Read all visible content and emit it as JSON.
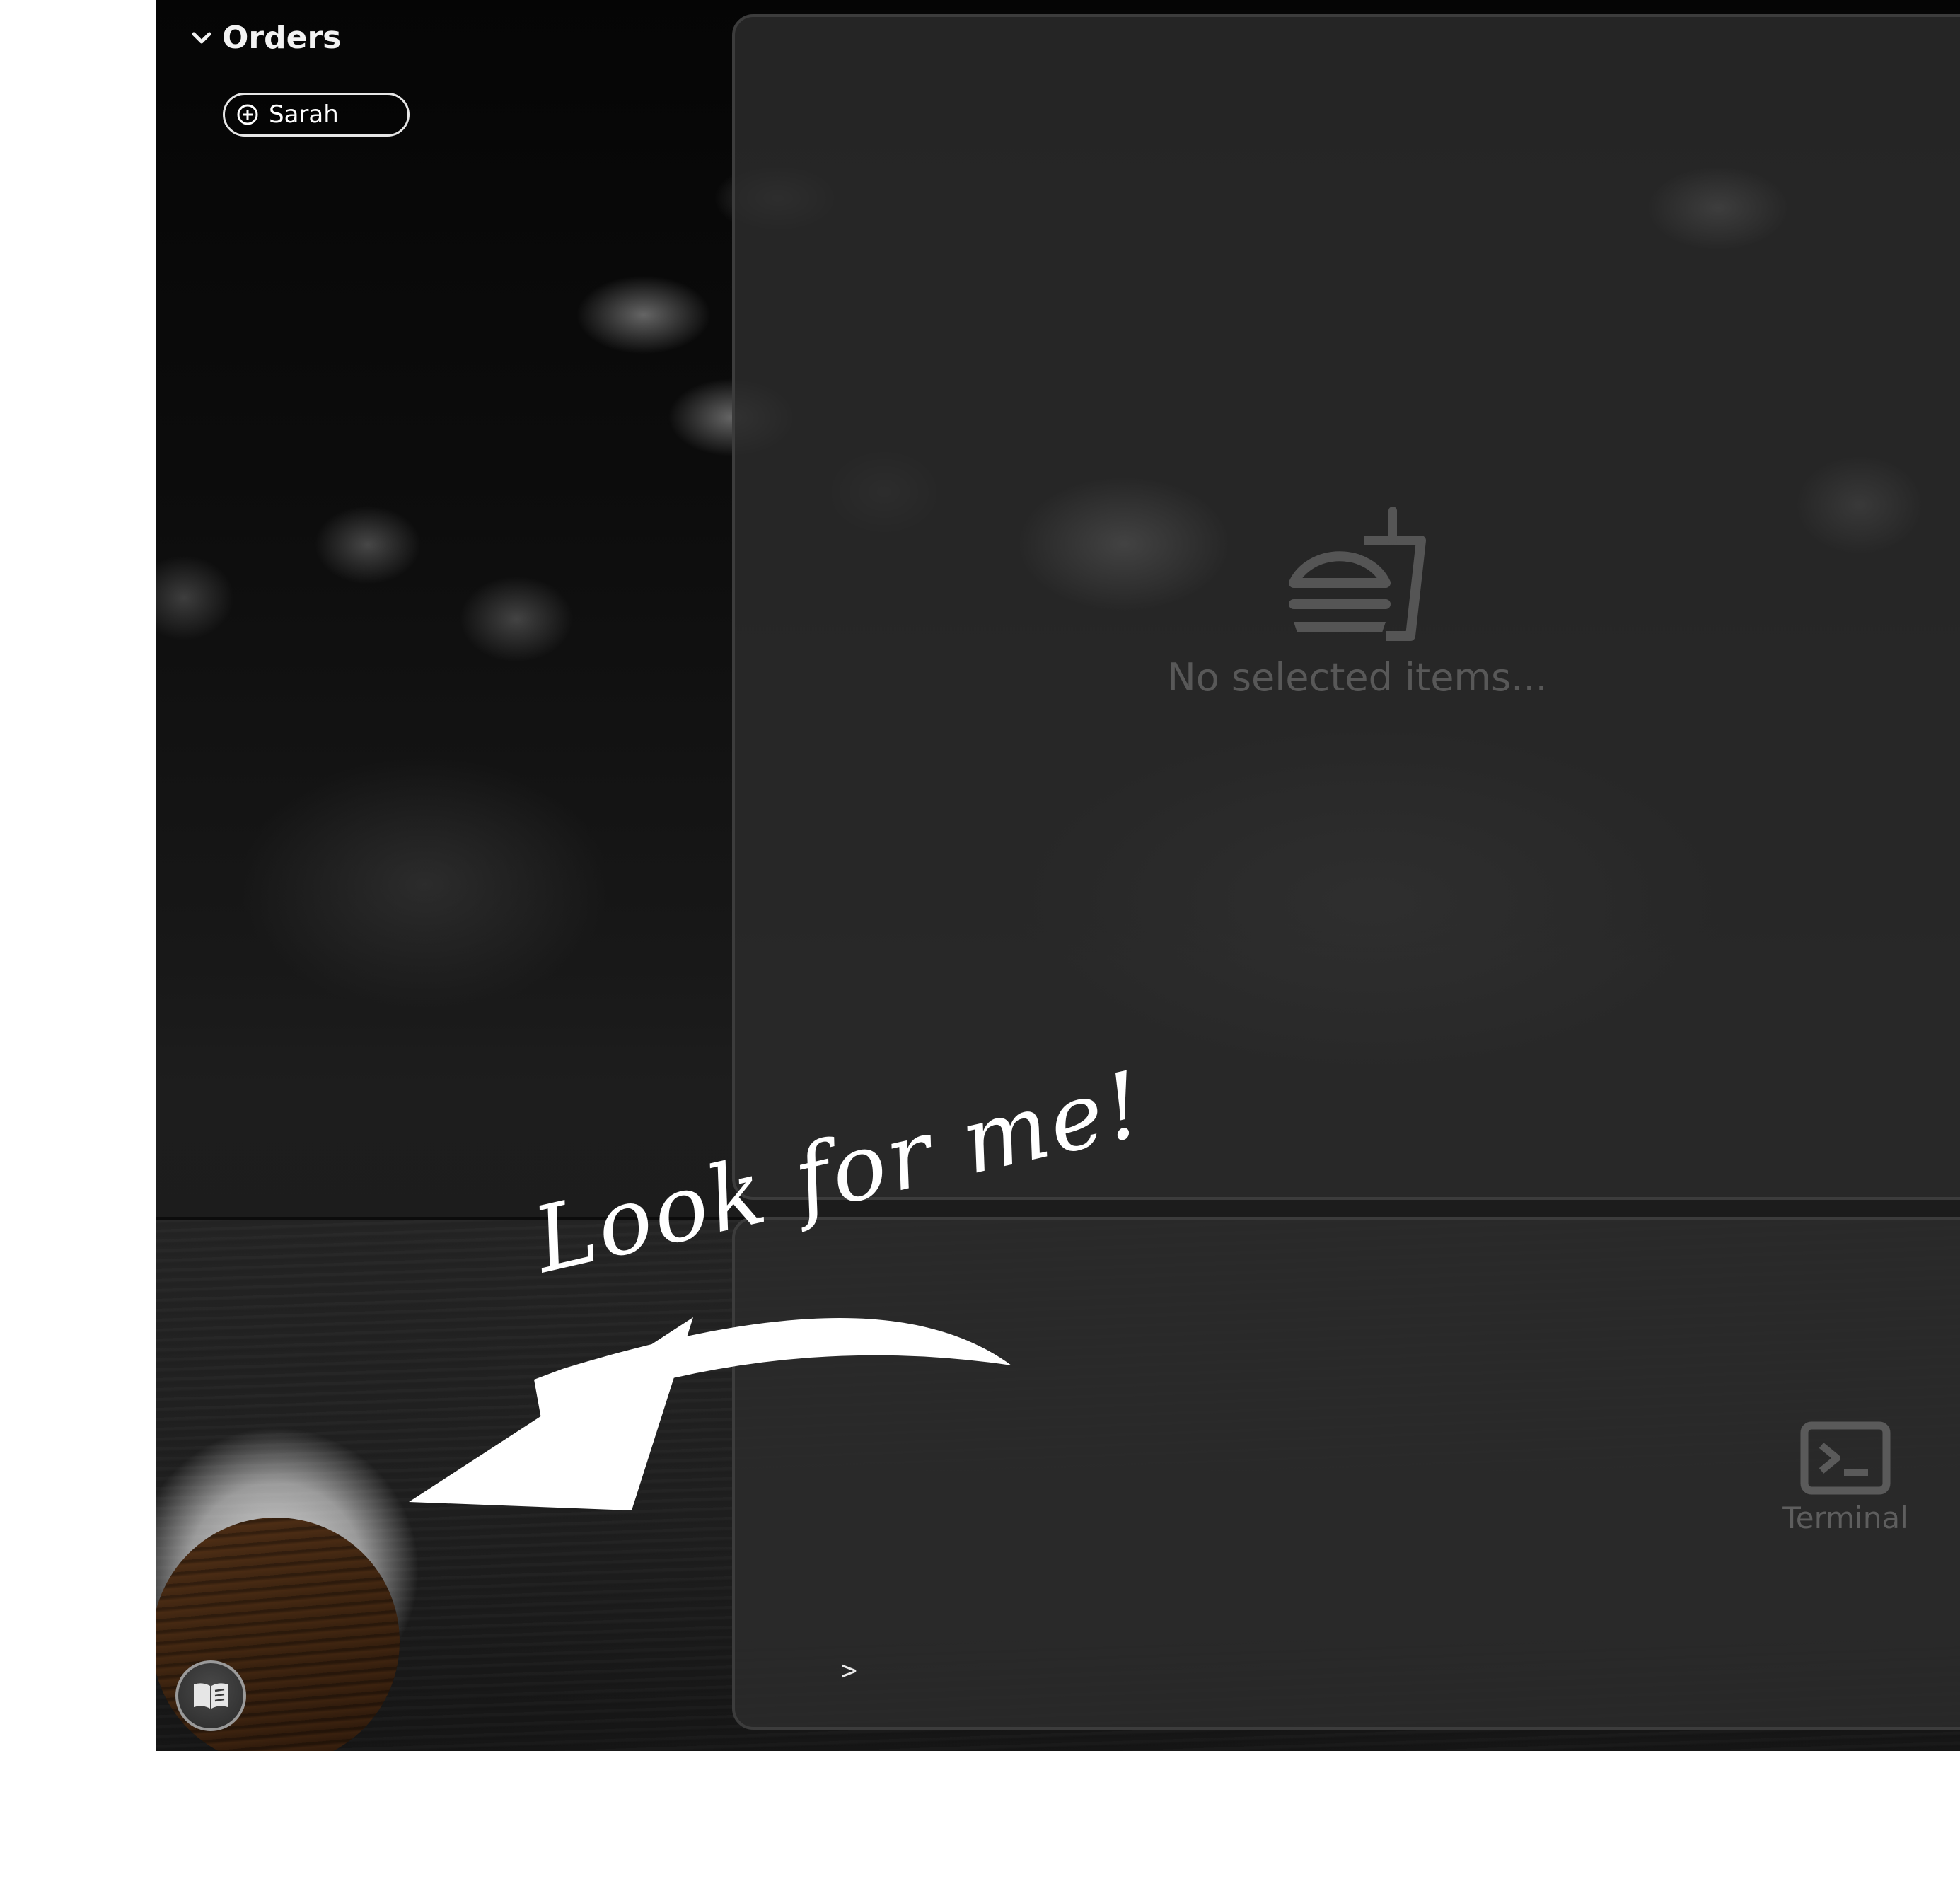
{
  "orders": {
    "heading": "Orders",
    "items": [
      {
        "name": "Sarah"
      }
    ]
  },
  "items_panel": {
    "empty_message": "No selected items..."
  },
  "terminal": {
    "label": "Terminal",
    "prompt": ">"
  },
  "annotation": {
    "text": "Look for me!"
  },
  "icons": {
    "expand": "chevron-down-icon",
    "add": "plus-circle-icon",
    "empty": "food-drink-icon",
    "terminal": "terminal-icon",
    "guide": "book-icon"
  },
  "colors": {
    "background": "#0d0d0d",
    "panel": "#2a2a2a",
    "panel_border": "#3c3c3c",
    "text_primary": "#f2f2f2",
    "text_muted": "#585858",
    "avatar": "#3a220f"
  }
}
